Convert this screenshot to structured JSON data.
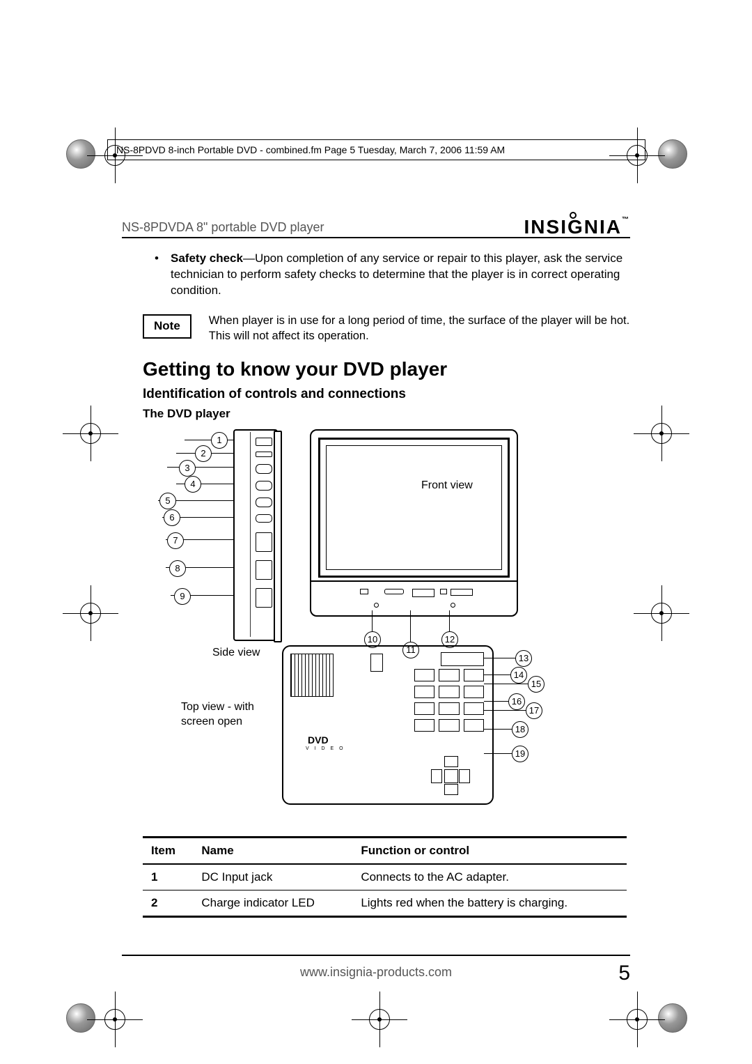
{
  "imprint": "NS-8PDVD 8-inch Portable DVD - combined.fm  Page 5  Tuesday, March 7, 2006  11:59 AM",
  "header_title": "NS-8PDVDA 8\" portable DVD player",
  "brand": "INSIGNIA",
  "brand_tm": "™",
  "safety_bold": "Safety check",
  "safety_text": "—Upon completion of any service or repair to this player, ask the service technician to perform safety checks to determine that the player is in correct operating condition.",
  "note_label": "Note",
  "note_text": "When player is in use for a long period of time, the surface of the player will be hot. This will not affect its operation.",
  "h_main": "Getting to know your DVD player",
  "h_sub": "Identification of controls and connections",
  "h_minor": "The DVD player",
  "labels": {
    "side": "Side view",
    "front": "Front view",
    "top": "Top view - with screen open",
    "dvd": "DVD",
    "dvd_sub": "V I D E O"
  },
  "callouts": {
    "c1": "1",
    "c2": "2",
    "c3": "3",
    "c4": "4",
    "c5": "5",
    "c6": "6",
    "c7": "7",
    "c8": "8",
    "c9": "9",
    "c10": "10",
    "c11": "11",
    "c12": "12",
    "c13": "13",
    "c14": "14",
    "c15": "15",
    "c16": "16",
    "c17": "17",
    "c18": "18",
    "c19": "19"
  },
  "table": {
    "headers": {
      "item": "Item",
      "name": "Name",
      "func": "Function or control"
    },
    "rows": [
      {
        "item": "1",
        "name": "DC Input jack",
        "func": "Connects to the AC adapter."
      },
      {
        "item": "2",
        "name": "Charge indicator LED",
        "func": "Lights red when the battery is charging."
      }
    ]
  },
  "footer_url": "www.insignia-products.com",
  "page_number": "5"
}
